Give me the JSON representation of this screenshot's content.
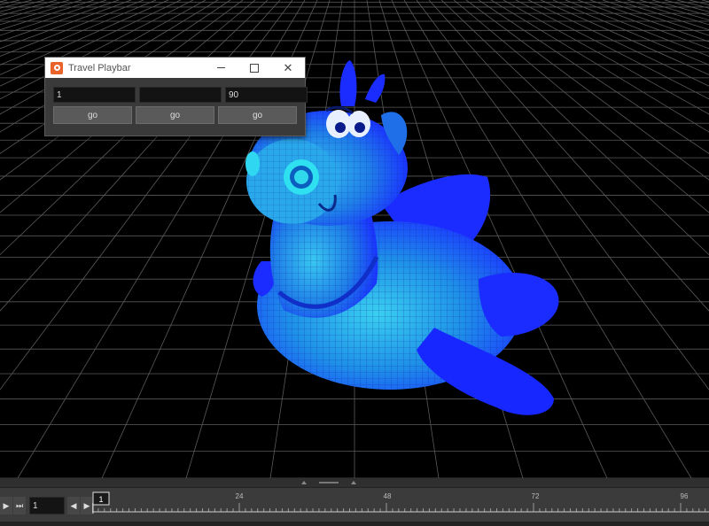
{
  "dialog": {
    "title": "Travel Playbar",
    "fields": [
      {
        "value": "1"
      },
      {
        "value": ""
      },
      {
        "value": "90"
      }
    ],
    "buttons": [
      {
        "label": "go"
      },
      {
        "label": "go"
      },
      {
        "label": "go"
      }
    ]
  },
  "timeline": {
    "current_frame": "1",
    "frame_input": "1",
    "ticks": [
      "24",
      "48",
      "72",
      "96"
    ]
  },
  "colors": {
    "model_primary": "#1a2cff",
    "model_secondary": "#1fb0e0",
    "grid": "#5a5a5a",
    "app_icon": "#e8622a"
  }
}
